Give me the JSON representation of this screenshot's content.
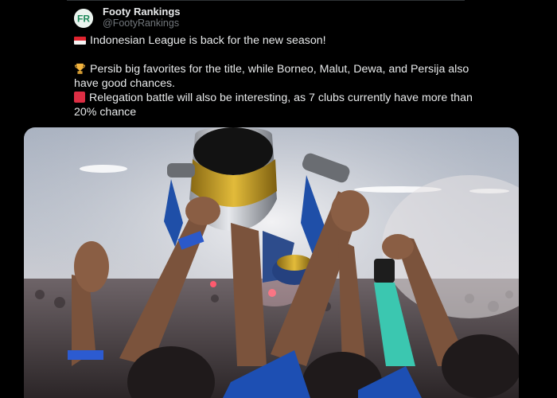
{
  "account": {
    "name": "Footy Rankings",
    "handle": "@FootyRankings",
    "avatar_initials": "FR"
  },
  "tweet": {
    "line1": "Indonesian League is back for the new season!",
    "line2": "Persib big favorites for the title, while Borneo, Malut, Dewa, and Persija also have good chances.",
    "line3": "Relegation battle will also be interesting, as 7 clubs currently have more than 20% chance",
    "icons": [
      "indonesia-flag-icon",
      "trophy-icon",
      "red-square-icon"
    ]
  },
  "media": {
    "type": "photo",
    "colors": {
      "accent_blue": "#1f5fbf",
      "gold": "#d4a623",
      "smoke": "#d8d6d9"
    }
  }
}
